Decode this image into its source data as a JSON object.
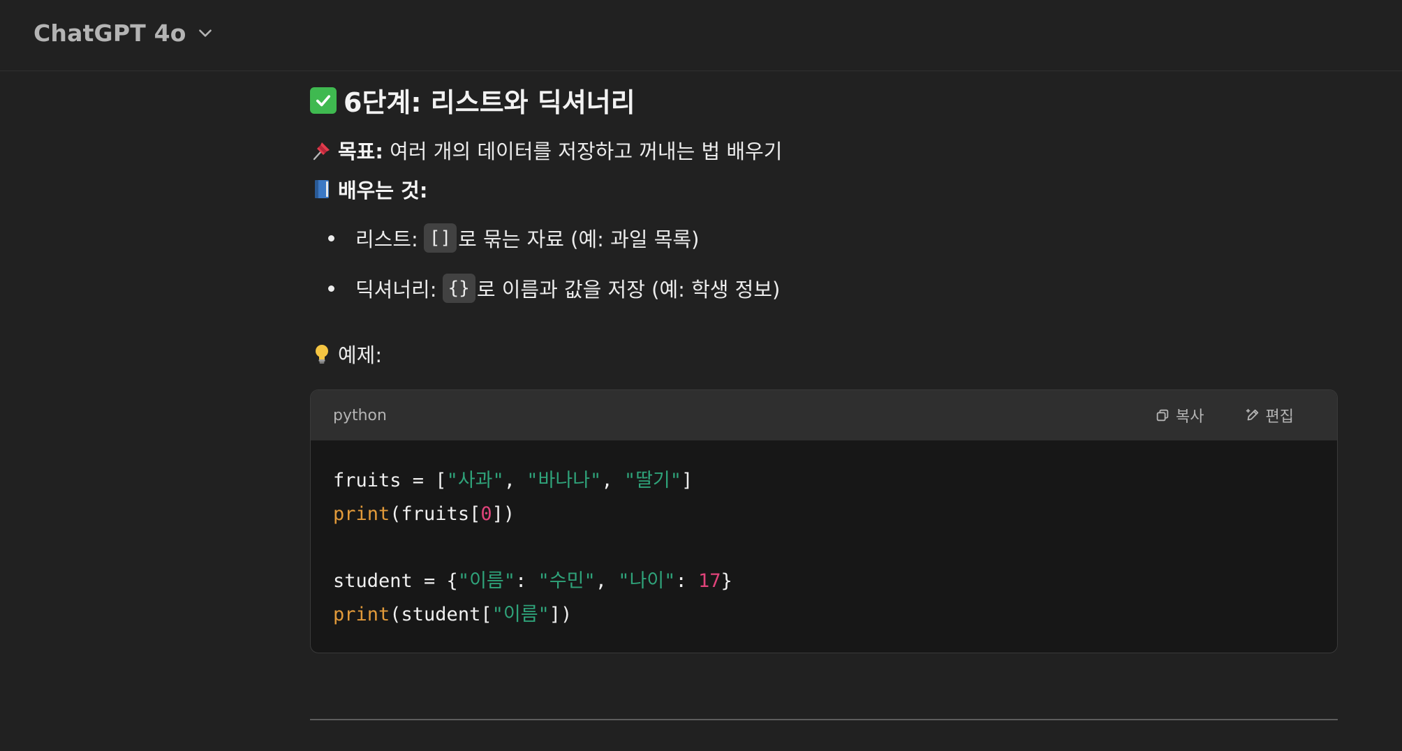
{
  "header": {
    "model_name": "ChatGPT 4o"
  },
  "message": {
    "heading": "6단계: 리스트와 딕셔너리",
    "goal_label": "목표:",
    "goal_text": " 여러 개의 데이터를 저장하고 꺼내는 법 배우기",
    "learn_label": "배우는 것:",
    "bullets": [
      {
        "prefix": "리스트:",
        "code": "[]",
        "suffix": "로 묶는 자료 (예: 과일 목록)"
      },
      {
        "prefix": "딕셔너리:",
        "code": "{}",
        "suffix": "로 이름과 값을 저장 (예: 학생 정보)"
      }
    ],
    "example_label": "예제:"
  },
  "code_block": {
    "language": "python",
    "copy_label": "복사",
    "edit_label": "편집",
    "lines": [
      [
        {
          "t": "fruits = [",
          "c": "plain"
        },
        {
          "t": "\"사과\"",
          "c": "str"
        },
        {
          "t": ", ",
          "c": "plain"
        },
        {
          "t": "\"바나나\"",
          "c": "str"
        },
        {
          "t": ", ",
          "c": "plain"
        },
        {
          "t": "\"딸기\"",
          "c": "str"
        },
        {
          "t": "]",
          "c": "plain"
        }
      ],
      [
        {
          "t": "print",
          "c": "fn"
        },
        {
          "t": "(fruits[",
          "c": "plain"
        },
        {
          "t": "0",
          "c": "num"
        },
        {
          "t": "])",
          "c": "plain"
        }
      ],
      [],
      [
        {
          "t": "student = {",
          "c": "plain"
        },
        {
          "t": "\"이름\"",
          "c": "str"
        },
        {
          "t": ": ",
          "c": "plain"
        },
        {
          "t": "\"수민\"",
          "c": "str"
        },
        {
          "t": ", ",
          "c": "plain"
        },
        {
          "t": "\"나이\"",
          "c": "str"
        },
        {
          "t": ": ",
          "c": "plain"
        },
        {
          "t": "17",
          "c": "num"
        },
        {
          "t": "}",
          "c": "plain"
        }
      ],
      [
        {
          "t": "print",
          "c": "fn"
        },
        {
          "t": "(student[",
          "c": "plain"
        },
        {
          "t": "\"이름\"",
          "c": "str"
        },
        {
          "t": "])",
          "c": "plain"
        }
      ]
    ]
  },
  "colors": {
    "background": "#212121",
    "code_string": "#2fa37a",
    "code_function": "#e29a3a",
    "code_number": "#e0437a"
  },
  "icons": {
    "model_dropdown": "chevron-down-icon",
    "heading": "check-mark-button-icon",
    "goal": "pushpin-icon",
    "learn": "blue-book-icon",
    "example": "light-bulb-icon",
    "copy": "copy-icon",
    "edit": "edit-icon"
  }
}
